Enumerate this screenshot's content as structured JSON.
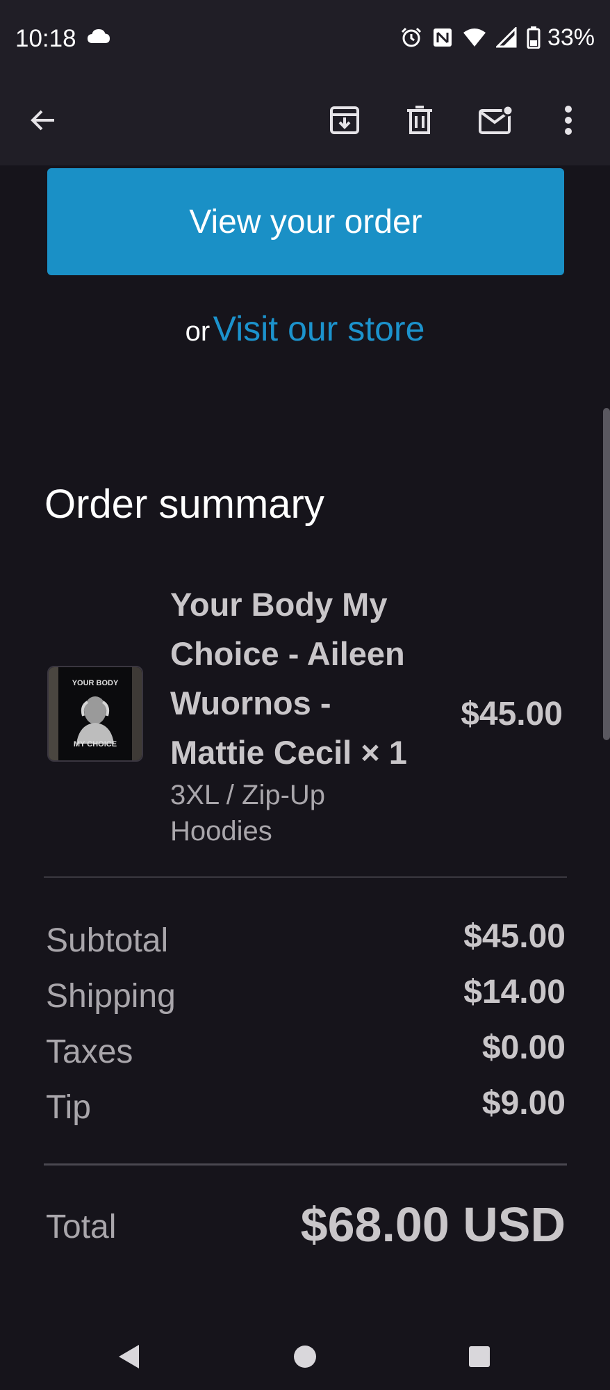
{
  "status_bar": {
    "time": "10:18",
    "battery": "33%",
    "icons": [
      "cloud-icon",
      "alarm-icon",
      "nfc-icon",
      "wifi-icon",
      "signal-icon",
      "battery-icon"
    ]
  },
  "app_bar": {
    "icons": [
      "back-arrow-icon",
      "archive-icon",
      "delete-icon",
      "mark-unread-icon",
      "more-vert-icon"
    ]
  },
  "email": {
    "view_order_button": "View your order",
    "visit_prefix": "or",
    "visit_link": "Visit our store",
    "section_title": "Order summary",
    "product": {
      "thumb_text_top": "YOUR BODY",
      "thumb_text_bottom": "MY CHOICE",
      "name_lines": [
        "Your Body My",
        "Choice - Aileen",
        "Wuornos -",
        "Mattie Cecil × 1"
      ],
      "variant_lines": [
        "3XL / Zip-Up",
        "Hoodies"
      ],
      "price": "$45.00"
    },
    "lines": [
      {
        "label": "Subtotal",
        "value": "$45.00"
      },
      {
        "label": "Shipping",
        "value": "$14.00"
      },
      {
        "label": "Taxes",
        "value": "$0.00"
      },
      {
        "label": "Tip",
        "value": "$9.00"
      }
    ],
    "total": {
      "label": "Total",
      "value": "$68.00 USD"
    }
  },
  "colors": {
    "accent": "#1a90c6",
    "link": "#1c93cd",
    "background": "#16141b",
    "bar": "#201e26"
  },
  "nav_bar": {
    "icons": [
      "back-triangle-icon",
      "home-circle-icon",
      "recents-square-icon"
    ]
  }
}
